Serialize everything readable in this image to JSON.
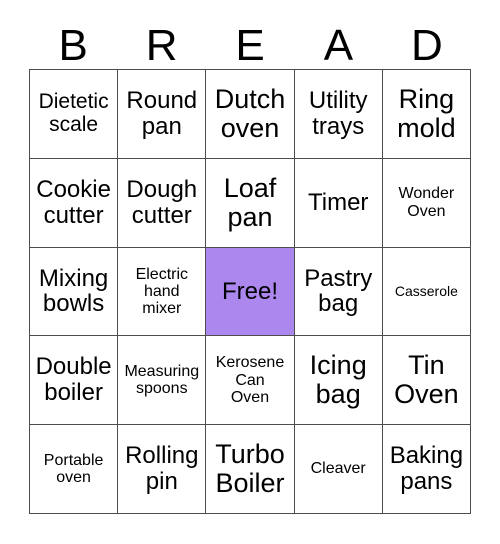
{
  "card": {
    "title_letters": [
      "B",
      "R",
      "E",
      "A",
      "D"
    ],
    "free_color": "#ab87ee",
    "border_color": "#4d4d4d",
    "background": "#ffffff",
    "columns": 5,
    "rows": 5,
    "cells": [
      {
        "text": "Dietetic\nscale",
        "size": "md",
        "free": false
      },
      {
        "text": "Round\npan",
        "size": "lg",
        "free": false
      },
      {
        "text": "Dutch\noven",
        "size": "xl",
        "free": false
      },
      {
        "text": "Utility\ntrays",
        "size": "lg",
        "free": false
      },
      {
        "text": "Ring\nmold",
        "size": "xl",
        "free": false
      },
      {
        "text": "Cookie\ncutter",
        "size": "lg",
        "free": false
      },
      {
        "text": "Dough\ncutter",
        "size": "lg",
        "free": false
      },
      {
        "text": "Loaf\npan",
        "size": "xl",
        "free": false
      },
      {
        "text": "Timer",
        "size": "lg",
        "free": false
      },
      {
        "text": "Wonder\nOven",
        "size": "sm",
        "free": false
      },
      {
        "text": "Mixing\nbowls",
        "size": "lg",
        "free": false
      },
      {
        "text": "Electric\nhand\nmixer",
        "size": "sm",
        "free": false
      },
      {
        "text": "Free!",
        "size": "lg",
        "free": true
      },
      {
        "text": "Pastry\nbag",
        "size": "lg",
        "free": false
      },
      {
        "text": "Casserole",
        "size": "xs",
        "free": false
      },
      {
        "text": "Double\nboiler",
        "size": "lg",
        "free": false
      },
      {
        "text": "Measuring\nspoons",
        "size": "sm",
        "free": false
      },
      {
        "text": "Kerosene\nCan\nOven",
        "size": "sm",
        "free": false
      },
      {
        "text": "Icing\nbag",
        "size": "xl",
        "free": false
      },
      {
        "text": "Tin\nOven",
        "size": "xl",
        "free": false
      },
      {
        "text": "Portable\noven",
        "size": "sm",
        "free": false
      },
      {
        "text": "Rolling\npin",
        "size": "lg",
        "free": false
      },
      {
        "text": "Turbo\nBoiler",
        "size": "xl",
        "free": false
      },
      {
        "text": "Cleaver",
        "size": "sm",
        "free": false
      },
      {
        "text": "Baking\npans",
        "size": "lg",
        "free": false
      }
    ]
  }
}
